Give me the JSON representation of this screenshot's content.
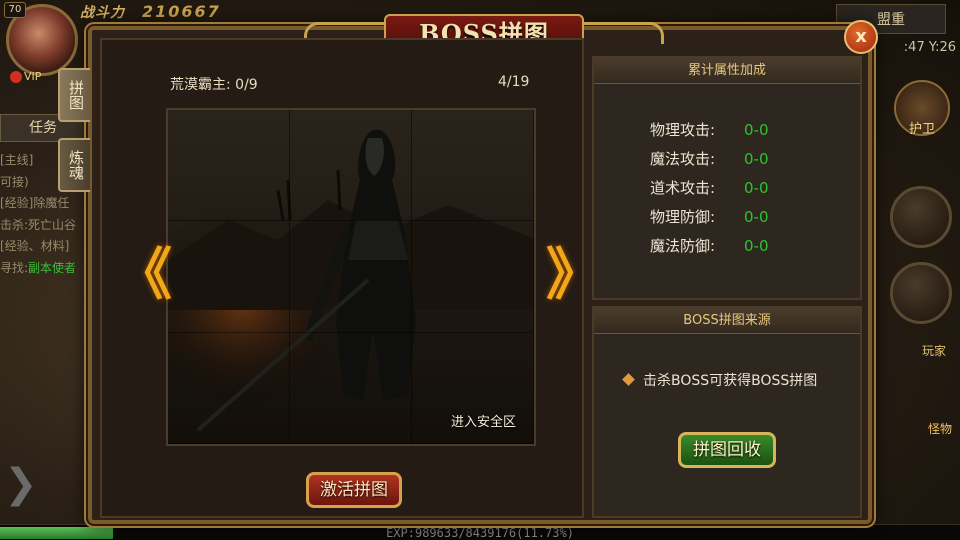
{
  "hud": {
    "level": "70",
    "power_label": "战斗力",
    "power_value": "210667",
    "vip_label": "VIP",
    "task_tab": "任务",
    "quest_lines": [
      {
        "tag": "[主线]",
        "text": ""
      },
      {
        "tag": "",
        "text": "可接)"
      },
      {
        "tag": "",
        "text": ""
      },
      {
        "tag": "[经验]",
        "text": "除魔任"
      },
      {
        "tag": "击杀:",
        "text": "死亡山谷"
      },
      {
        "tag": "",
        "text": ""
      },
      {
        "tag": "[经验、材料]",
        "text": ""
      },
      {
        "tag": "寻找:",
        "text": "副本使者"
      }
    ],
    "alliance_label": "盟重",
    "coords": ":47 Y:26",
    "guard_label": "护卫",
    "player_label": "玩家",
    "monster_label": "怪物",
    "exp_text": "EXP:989633/8439176(11.73%)",
    "exp_fraction": 0.1173
  },
  "dialog": {
    "title": "BOSS拼图",
    "close_glyph": "x",
    "side_tabs": [
      "拼图",
      "炼魂"
    ],
    "boss_progress": "荒漠霸主: 0/9",
    "page_indicator": "4/19",
    "safe_zone_text": "进入安全区",
    "activate_label": "激活拼图",
    "prev_glyph": "《",
    "next_glyph": "》",
    "attr_header": "累计属性加成",
    "attributes": [
      {
        "name": "物理攻击:",
        "value": "0-0"
      },
      {
        "name": "魔法攻击:",
        "value": "0-0"
      },
      {
        "name": "道术攻击:",
        "value": "0-0"
      },
      {
        "name": "物理防御:",
        "value": "0-0"
      },
      {
        "name": "魔法防御:",
        "value": "0-0"
      }
    ],
    "source_header": "BOSS拼图来源",
    "source_text": "击杀BOSS可获得BOSS拼图",
    "recycle_label": "拼图回收"
  },
  "colors": {
    "accent_gold": "#c9a24c",
    "stat_green": "#2ec42e",
    "arrow_orange": "#f0a818",
    "title_red": "#7a1a12"
  }
}
